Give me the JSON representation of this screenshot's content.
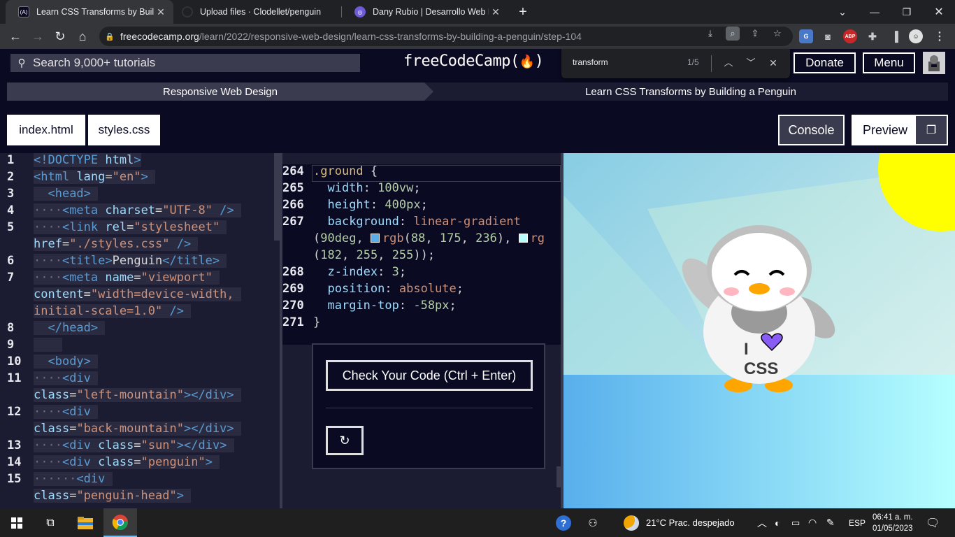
{
  "browser": {
    "tabs": [
      {
        "title": "Learn CSS Transforms by Building",
        "active": true,
        "favicon": "freecodecamp-icon"
      },
      {
        "title": "Upload files · Clodellet/penguin",
        "active": false,
        "favicon": "github-icon"
      },
      {
        "title": "Dany Rubio | Desarrollo Web Fron",
        "active": false,
        "favicon": "site-icon"
      }
    ],
    "new_tab": "+",
    "url_host": "freecodecamp.org",
    "url_path": "/learn/2022/responsive-web-design/learn-css-transforms-by-building-a-penguin/step-104"
  },
  "find_bar": {
    "query": "transform",
    "count": "1/5"
  },
  "fcc": {
    "search_placeholder": "Search 9,000+ tutorials",
    "logo": "freeCodeCamp(☲)",
    "logo_text": "freeCodeCamp(",
    "logo_close": ")",
    "donate": "Donate",
    "menu": "Menu",
    "breadcrumb": [
      "Responsive Web Design",
      "Learn CSS Transforms by Building a Penguin"
    ],
    "file_tabs": [
      "index.html",
      "styles.css"
    ],
    "console_label": "Console",
    "preview_label": "Preview",
    "check_code": "Check Your Code (Ctrl + Enter)",
    "accent": "#0a0a23"
  },
  "html_editor": {
    "line_numbers": [
      "1",
      "2",
      "3",
      "4",
      "5",
      "",
      "6",
      "7",
      "",
      "",
      "8",
      "9",
      "10",
      "11",
      "",
      "12",
      "",
      "13",
      "14",
      "15",
      ""
    ]
  },
  "css_editor": {
    "line_numbers": [
      "264",
      "265",
      "266",
      "267",
      "",
      "",
      "268",
      "269",
      "270",
      "271"
    ]
  },
  "preview": {
    "penguin_text_i": "I",
    "penguin_text_css": "CSS"
  },
  "taskbar": {
    "weather": "21°C  Prac. despejado",
    "lang": "ESP",
    "time": "06:41 a. m.",
    "date": "01/05/2023"
  }
}
